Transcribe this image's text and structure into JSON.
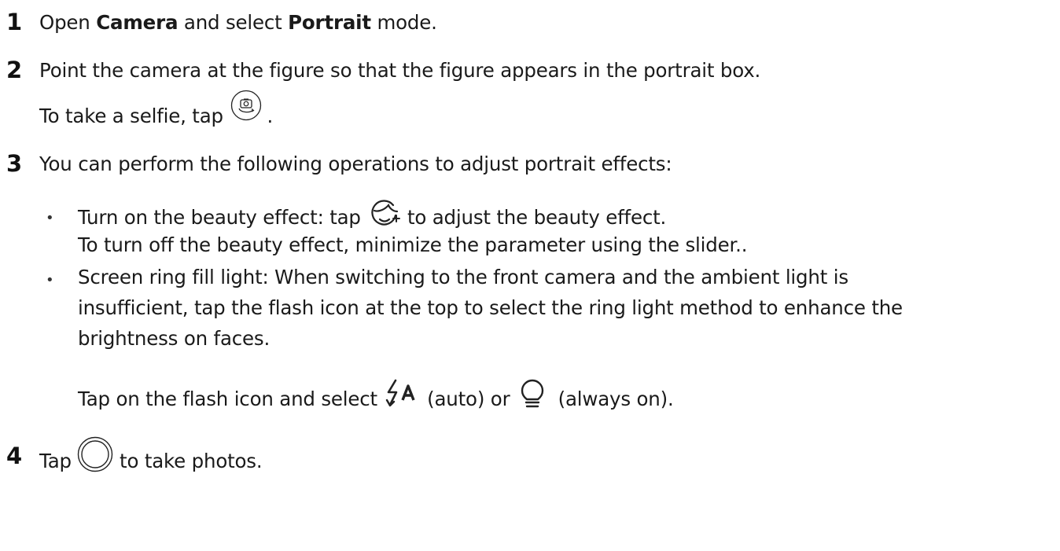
{
  "steps": [
    {
      "number": "1",
      "pre": "Open ",
      "bold1": "Camera",
      "mid": " and select ",
      "bold2": "Portrait",
      "post": " mode."
    },
    {
      "number": "2",
      "text": "Point the camera at the figure so that the figure appears in the portrait box.",
      "sub_pre": "To take a selfie, tap ",
      "sub_post": ".",
      "sub_icon": "switch-camera-icon"
    },
    {
      "number": "3",
      "text": "You can perform the following operations to adjust portrait effects:",
      "bullets": [
        {
          "pre": "Turn on the beauty effect: tap ",
          "icon": "beauty-face-icon",
          "post": " to adjust the beauty effect.",
          "line2": "To turn off the beauty effect, minimize the parameter using the slider.."
        },
        {
          "line1": "Screen ring fill light: When switching to the front camera and the ambient light is",
          "line2": "insufficient, tap the flash icon at the top to select the ring light method to enhance the",
          "line3": "brightness on faces."
        }
      ],
      "flash": {
        "pre": "Tap on the flash icon and select ",
        "icon_auto": "flash-auto-icon",
        "mid": " (auto) or ",
        "icon_on": "bulb-icon",
        "post": " (always on)."
      }
    },
    {
      "number": "4",
      "pre": "Tap ",
      "icon": "shutter-icon",
      "post": " to take photos."
    }
  ],
  "bullet_glyph": "•"
}
